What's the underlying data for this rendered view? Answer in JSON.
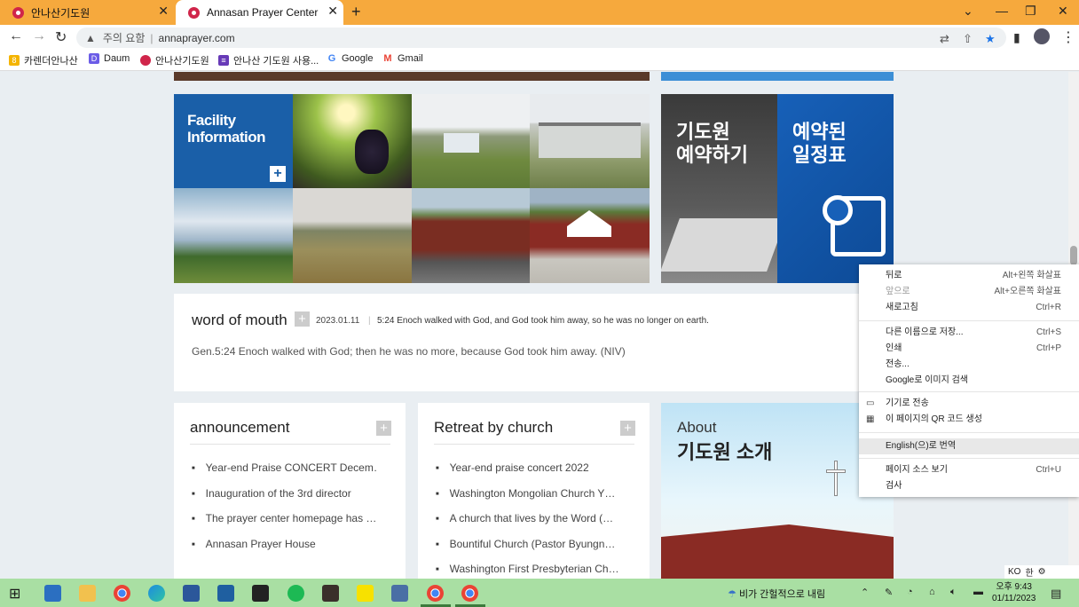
{
  "browser": {
    "tabs": [
      {
        "title": "안나산기도원"
      },
      {
        "title": "Annasan Prayer Center"
      }
    ],
    "new_tab": "+",
    "address": {
      "warning": "주의 요함",
      "url": "annaprayer.com"
    },
    "bookmarks": [
      "카렌더안나산",
      "Daum",
      "안나산기도원",
      "안나산 기도원 사용...",
      "Google",
      "Gmail"
    ]
  },
  "page": {
    "facility": {
      "title": "Facility Information",
      "plus": "+"
    },
    "reserve": {
      "title_line1": "기도원",
      "title_line2": "예약하기"
    },
    "schedule": {
      "title_line1": "예약된",
      "title_line2": "일정표"
    },
    "word_of_mouth": {
      "heading": "word of mouth",
      "plus": "+",
      "date": "2023.01.11",
      "sep": "|",
      "summary": "5:24 Enoch walked with God, and God took him away, so he was no longer on earth.",
      "body": "Gen.5:24 Enoch walked with God; then he was no more, because God took him away. (NIV)"
    },
    "announcement": {
      "heading": "announcement",
      "plus": "+",
      "items": [
        "Year-end Praise CONCERT Decem…",
        "Inauguration of the 3rd director",
        "The prayer center homepage has …",
        "Annasan Prayer House"
      ]
    },
    "retreat": {
      "heading": "Retreat by church",
      "plus": "+",
      "items": [
        "Year-end praise concert 2022",
        "Washington Mongolian Church Y…",
        "A church that lives by the Word (…",
        "Bountiful Church (Pastor Byungn…",
        "Washington First Presbyterian Ch…"
      ]
    },
    "about": {
      "line1": "About",
      "line2": "기도원 소개"
    }
  },
  "context_menu": {
    "items": [
      {
        "label": "뒤로",
        "shortcut": "Alt+왼쪽 화살표"
      },
      {
        "label": "앞으로",
        "shortcut": "Alt+오른쪽 화살표"
      },
      {
        "label": "새로고침",
        "shortcut": "Ctrl+R"
      },
      {
        "label": "다른 이름으로 저장...",
        "shortcut": "Ctrl+S"
      },
      {
        "label": "인쇄",
        "shortcut": "Ctrl+P"
      },
      {
        "label": "전송..."
      },
      {
        "label": "Google로 이미지 검색"
      },
      {
        "label": "기기로 전송"
      },
      {
        "label": "이 페이지의 QR 코드 생성"
      },
      {
        "label": "English(으)로 번역"
      },
      {
        "label": "페이지 소스 보기",
        "shortcut": "Ctrl+U"
      },
      {
        "label": "검사"
      }
    ]
  },
  "ime": {
    "lang": "KO",
    "mode": "한"
  },
  "taskbar": {
    "weather": "비가 간헐적으로 내림",
    "time": "오후 9:43",
    "date": "01/11/2023"
  }
}
